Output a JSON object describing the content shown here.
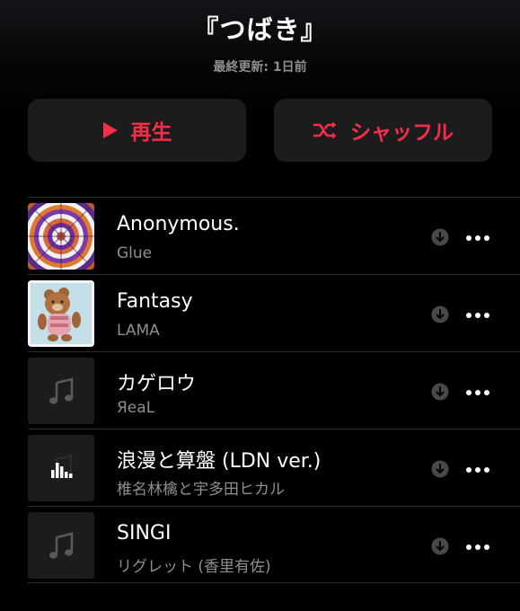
{
  "header": {
    "title": "『つばき』",
    "updated": "最終更新: 1日前"
  },
  "actions": {
    "play_label": "再生",
    "shuffle_label": "シャッフル",
    "accent_color": "#fa2d48"
  },
  "tracks": [
    {
      "title": "Anonymous.",
      "artist": "Glue",
      "artwork": "spiral-pattern-artwork",
      "downloadable": true
    },
    {
      "title": "Fantasy",
      "artist": "LAMA",
      "artwork": "teddy-bear-artwork",
      "downloadable": true
    },
    {
      "title": "カゲロウ",
      "artist": "ЯeaL",
      "artwork": "music-note-placeholder",
      "downloadable": true
    },
    {
      "title": "浪漫と算盤 (LDN ver.)",
      "artist": "椎名林檎と宇多田ヒカル",
      "artwork": "now-playing-bars",
      "downloadable": true
    },
    {
      "title": "SINGI",
      "artist": "リグレット (香里有佐)",
      "artwork": "music-note-placeholder",
      "downloadable": true
    }
  ]
}
